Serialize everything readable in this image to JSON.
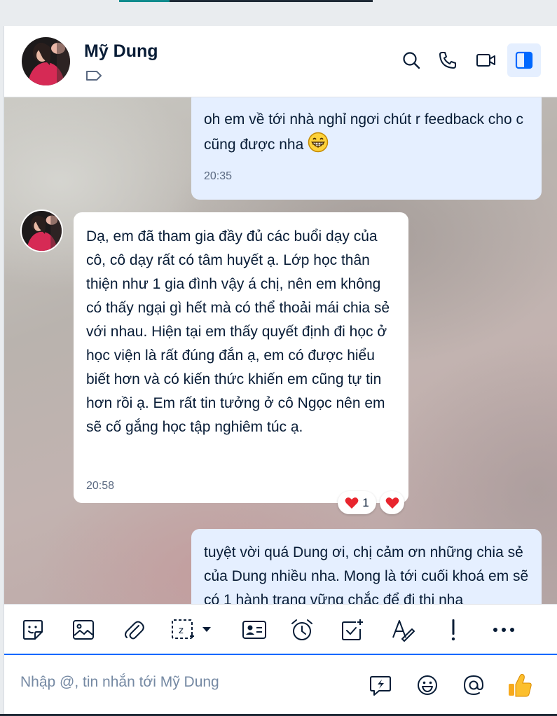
{
  "header": {
    "contact_name": "Mỹ Dung",
    "icons": [
      "search-icon",
      "phone-icon",
      "video-call-icon",
      "sidebar-toggle-icon",
      "tag-icon"
    ]
  },
  "messages": [
    {
      "id": "m1",
      "from": "me",
      "text": "oh em về tới nhà nghỉ ngơi chút r feedback cho c cũng được nha",
      "emoji": "😁",
      "time": "20:35"
    },
    {
      "id": "m2",
      "from": "contact",
      "text": "Dạ, em đã tham gia đầy đủ các buổi dạy của cô, cô dạy rất có tâm huyết ạ. Lớp học thân thiện như 1 gia đình vậy á chị, nên em không có thấy ngại gì hết mà có thể thoải mái chia sẻ với nhau. Hiện tại em thấy quyết định đi học ở học viện là rất đúng đắn ạ, em có được hiểu biết hơn và có kiến thức khiến em cũng tự tin hơn rồi ạ. Em rất tin tưởng ở cô Ngọc nên em sẽ cố gắng học tập nghiêm túc ạ.",
      "time": "20:58",
      "reaction": {
        "emoji": "❤️",
        "count": "1"
      }
    },
    {
      "id": "m3",
      "from": "me",
      "text": "tuyệt vời quá Dung ơi, chị cảm ơn những chia sẻ của Dung nhiều nha. Mong là tới cuối khoá em sẽ có 1 hành trang vững chắc để đi thi nha"
    }
  ],
  "toolbar": {
    "icons": [
      "sticker-icon",
      "image-icon",
      "attachment-icon",
      "screenshot-icon",
      "business-card-icon",
      "reminder-clock-icon",
      "task-check-icon",
      "text-format-icon",
      "urgent-exclamation-icon",
      "more-icon"
    ]
  },
  "composer": {
    "placeholder": "Nhập @, tin nhắn tới Mỹ Dung",
    "icons": [
      "quick-message-icon",
      "emoji-icon",
      "mention-icon",
      "thumbs-up-icon"
    ]
  },
  "colors": {
    "accent": "#0068ff",
    "my_bubble": "#e5efff",
    "their_bubble": "#ffffff",
    "heart": "#e8252e"
  }
}
